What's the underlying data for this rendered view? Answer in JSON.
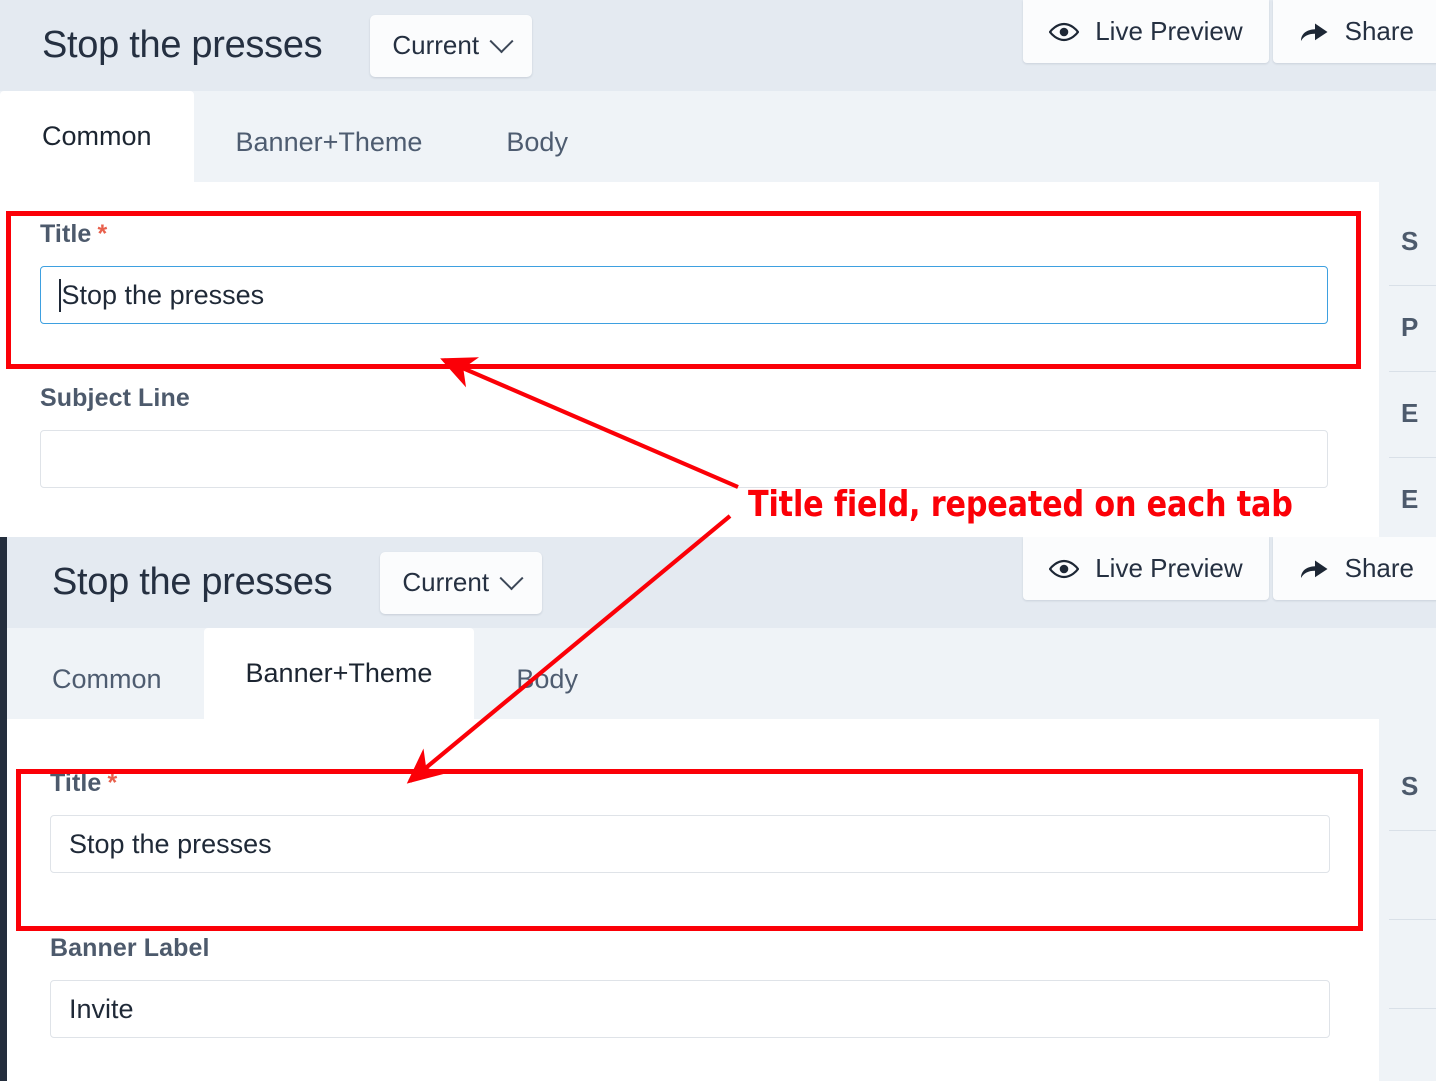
{
  "annotation": {
    "callout_text": "Title field, repeated on each tab",
    "color": "#fb0007"
  },
  "theme": {
    "header_bg": "#e4eaf1",
    "tabbar_bg": "#eff3f7",
    "panel_bg": "#ffffff",
    "chrome_edge": "#242e3d",
    "focus_border": "#3ea0e0",
    "required_star": "#e8604c",
    "label_color": "#4d5a6c"
  },
  "screenshots": [
    {
      "id": "common-tab-shot",
      "header": {
        "title": "Stop the presses",
        "version_chip": {
          "label": "Current",
          "icon": "chevron-down-icon"
        },
        "actions": [
          {
            "label": "Live Preview",
            "icon": "eye-icon"
          },
          {
            "label": "Share",
            "icon": "share-arrow-icon"
          }
        ]
      },
      "tabs": [
        {
          "label": "Common",
          "active": true
        },
        {
          "label": "Banner+Theme",
          "active": false
        },
        {
          "label": "Body",
          "active": false
        }
      ],
      "fields": [
        {
          "label": "Title",
          "required": true,
          "value": "Stop the presses",
          "placeholder": "",
          "focused": true,
          "highlighted": true
        },
        {
          "label": "Subject Line",
          "required": false,
          "value": "",
          "placeholder": "",
          "focused": false,
          "highlighted": false
        }
      ],
      "rail_items": [
        "S",
        "P",
        "E",
        "E"
      ]
    },
    {
      "id": "banner-theme-tab-shot",
      "header": {
        "title": "Stop the presses",
        "version_chip": {
          "label": "Current",
          "icon": "chevron-down-icon"
        },
        "actions": [
          {
            "label": "Live Preview",
            "icon": "eye-icon"
          },
          {
            "label": "Share",
            "icon": "share-arrow-icon"
          }
        ]
      },
      "tabs": [
        {
          "label": "Common",
          "active": false
        },
        {
          "label": "Banner+Theme",
          "active": true
        },
        {
          "label": "Body",
          "active": false
        }
      ],
      "fields": [
        {
          "label": "Title",
          "required": true,
          "value": "Stop the presses",
          "placeholder": "",
          "focused": false,
          "highlighted": true
        },
        {
          "label": "Banner Label",
          "required": false,
          "value": "Invite",
          "placeholder": "",
          "focused": false,
          "highlighted": false
        }
      ],
      "rail_items": [
        "S",
        "",
        "",
        ""
      ]
    }
  ]
}
